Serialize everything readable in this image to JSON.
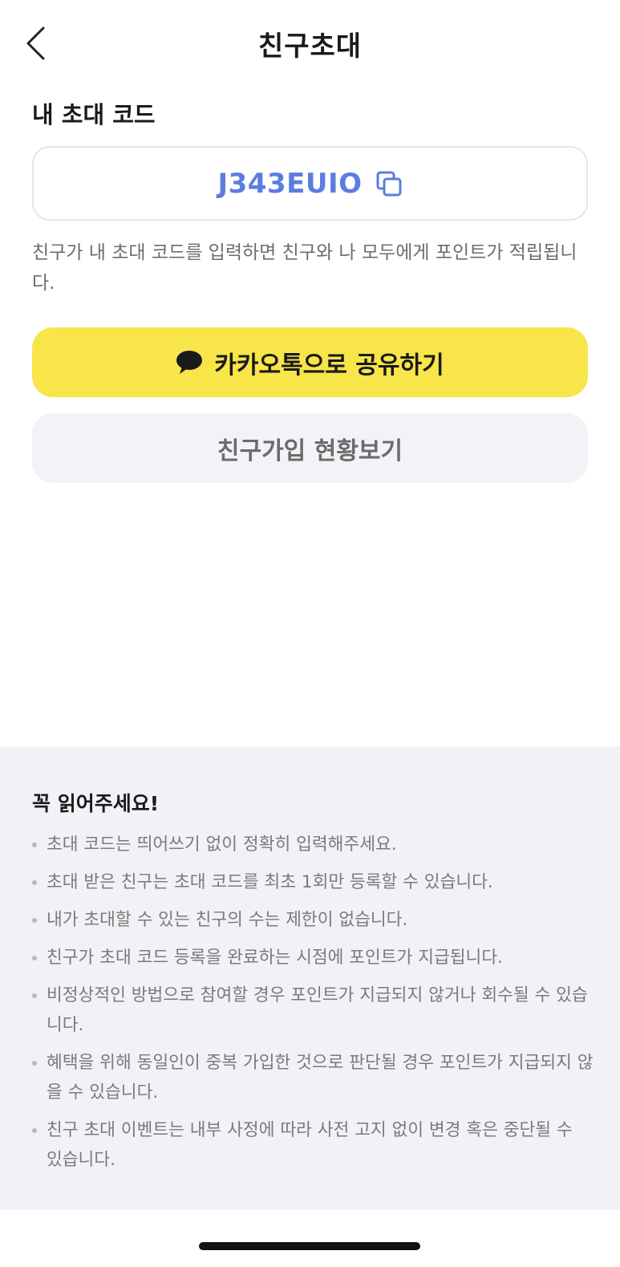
{
  "header": {
    "title": "친구초대",
    "back_icon": "chevron-left-icon"
  },
  "invite": {
    "section_title": "내 초대 코드",
    "code": "J343EUIO",
    "copy_icon": "copy-icon",
    "description": "친구가 내 초대 코드를 입력하면 친구와 나 모두에게 포인트가 적립됩니다."
  },
  "actions": {
    "kakao_label": "카카오톡으로 공유하기",
    "kakao_icon": "speech-bubble-icon",
    "status_label": "친구가입 현황보기"
  },
  "notice": {
    "title": "꼭 읽어주세요!",
    "items": [
      "초대 코드는 띄어쓰기 없이 정확히 입력해주세요.",
      "초대 받은 친구는 초대 코드를 최초 1회만 등록할 수 있습니다.",
      "내가 초대할 수 있는 친구의 수는 제한이 없습니다.",
      "친구가 초대 코드 등록을 완료하는 시점에 포인트가 지급됩니다.",
      "비정상적인 방법으로 참여할 경우 포인트가 지급되지 않거나 회수될 수 있습니다.",
      "혜택을 위해 동일인이 중복 가입한 것으로 판단될 경우 포인트가 지급되지 않을 수 있습니다.",
      "친구 초대 이벤트는 내부 사정에 따라 사전 고지 없이 변경 혹은 중단될 수 있습니다."
    ]
  },
  "colors": {
    "accent_blue": "#5b7de0",
    "kakao_yellow": "#f8e54a",
    "notice_bg": "#f0f2f5"
  }
}
